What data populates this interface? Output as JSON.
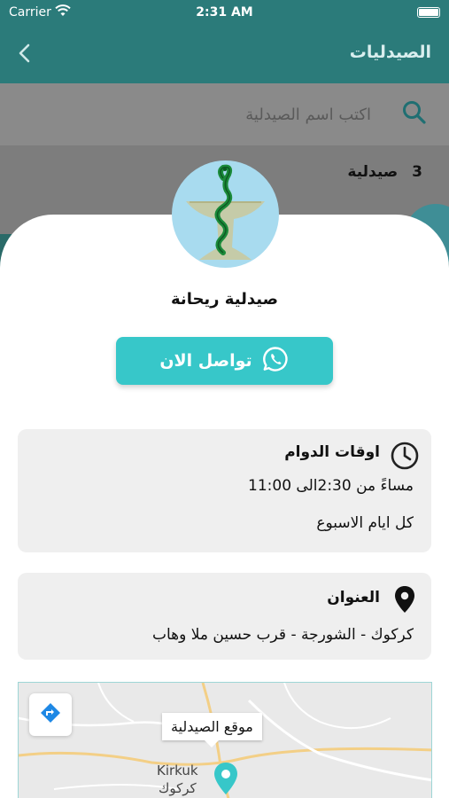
{
  "status_bar": {
    "carrier": "Carrier",
    "time": "2:31 AM"
  },
  "nav": {
    "title": "الصيدليات"
  },
  "search": {
    "placeholder": "اكتب اسم الصيدلية"
  },
  "list": {
    "count": "3",
    "count_label": "صيدلية"
  },
  "pharmacy": {
    "name": "صيدلية ريحانة",
    "contact_label": "تواصل الان"
  },
  "hours": {
    "title": "اوقات الدوام",
    "time_range": "مساءً من 2:30الى 11:00",
    "days": "كل ايام الاسبوع"
  },
  "address": {
    "title": "العنوان",
    "value": "كركوك - الشورجة - قرب حسين ملا وهاب"
  },
  "map": {
    "callout": "موقع الصيدلية",
    "city_en": "Kirkuk",
    "city_ar": "كركوك"
  },
  "colors": {
    "primary": "#2b7b7a",
    "accent": "#37c7c9",
    "card_bg": "#efefef"
  },
  "icons": [
    "back-chevron-icon",
    "search-icon",
    "whatsapp-icon",
    "clock-icon",
    "location-pin-icon",
    "directions-icon",
    "map-pin-icon"
  ]
}
